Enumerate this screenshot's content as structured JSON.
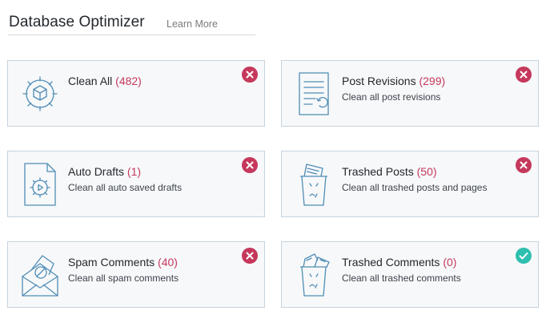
{
  "header": {
    "title": "Database Optimizer",
    "learn_more": "Learn More"
  },
  "colors": {
    "accent_count": "#c5385c",
    "error_badge": "#c5385c",
    "ok_badge": "#2fbfb0",
    "icon_stroke": "#4f8db5"
  },
  "cards": [
    {
      "name": "Clean All",
      "count": "(482)",
      "description": "",
      "status": "error",
      "icon": "gear-cube-icon"
    },
    {
      "name": "Post Revisions",
      "count": "(299)",
      "description": "Clean all post revisions",
      "status": "error",
      "icon": "document-refresh-icon"
    },
    {
      "name": "Auto Drafts",
      "count": "(1)",
      "description": "Clean all auto saved drafts",
      "status": "error",
      "icon": "document-gear-icon"
    },
    {
      "name": "Trashed Posts",
      "count": "(50)",
      "description": "Clean all trashed posts and pages",
      "status": "error",
      "icon": "trash-posts-icon"
    },
    {
      "name": "Spam Comments",
      "count": "(40)",
      "description": "Clean all spam comments",
      "status": "error",
      "icon": "spam-envelope-icon"
    },
    {
      "name": "Trashed Comments",
      "count": "(0)",
      "description": "Clean all trashed comments",
      "status": "ok",
      "icon": "trash-comments-icon"
    }
  ]
}
